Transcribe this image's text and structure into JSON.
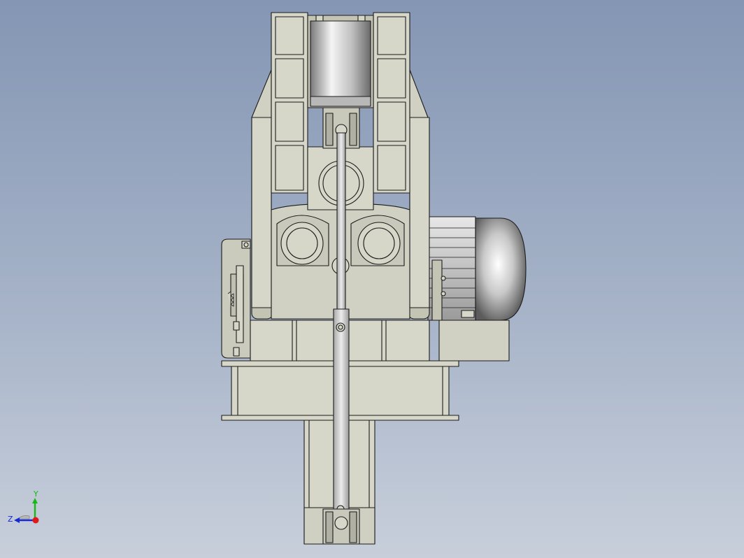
{
  "viewport": {
    "background_top": "#8496b4",
    "background_bottom": "#c8cfdb",
    "model_fill": "#d6d6c9",
    "model_shade": "#c4c4b4",
    "edge_color": "#1c1c1c",
    "metal_light": "#f2f2f2",
    "metal_dark": "#6c6c6c"
  },
  "triad": {
    "x_label": "",
    "y_label": "Y",
    "z_label": "Z",
    "x_color": "#e01818",
    "y_color": "#18b818",
    "z_color": "#1828d0"
  }
}
